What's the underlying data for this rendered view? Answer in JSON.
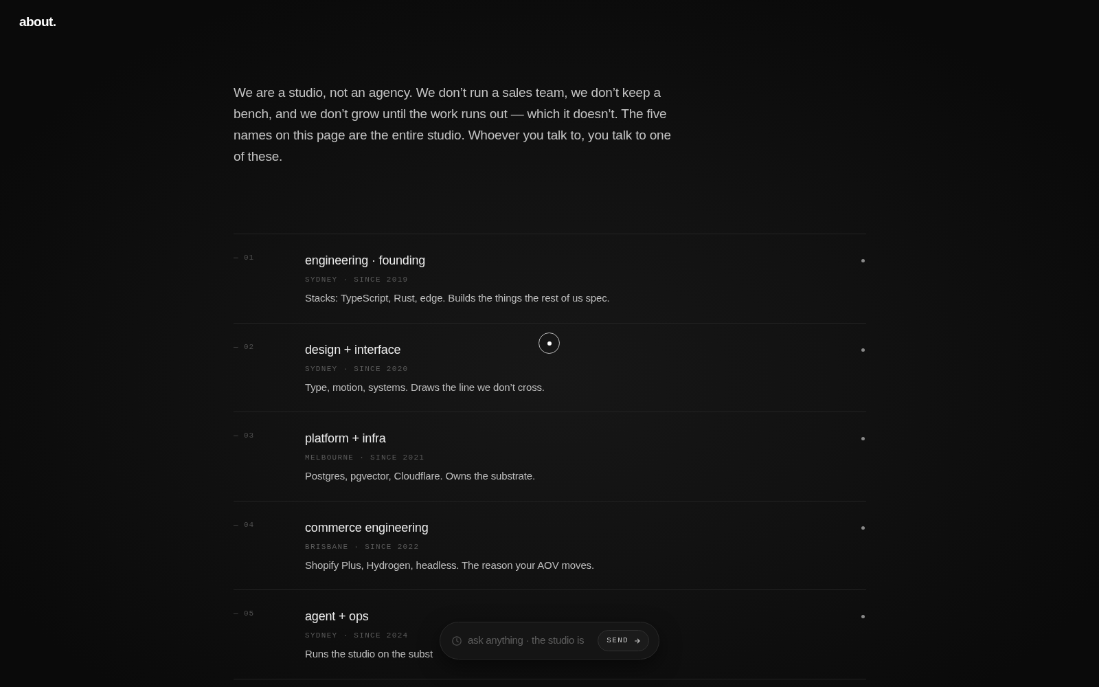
{
  "logo": "about.",
  "intro": "We are a studio, not an agency. We don’t run a sales team, we don’t keep a bench, and we don’t grow until the work runs out — which it doesn’t. The five names on this page are the entire studio. Whoever you talk to, you talk to one of these.",
  "team": [
    {
      "number": "— 01",
      "title": "engineering · founding",
      "meta": "SYDNEY · SINCE 2019",
      "description": "Stacks: TypeScript, Rust, edge. Builds the things the rest of us spec."
    },
    {
      "number": "— 02",
      "title": "design + interface",
      "meta": "SYDNEY · SINCE 2020",
      "description": "Type, motion, systems. Draws the line we don’t cross."
    },
    {
      "number": "— 03",
      "title": "platform + infra",
      "meta": "MELBOURNE · SINCE 2021",
      "description": "Postgres, pgvector, Cloudflare. Owns the substrate."
    },
    {
      "number": "— 04",
      "title": "commerce engineering",
      "meta": "BRISBANE · SINCE 2022",
      "description": "Shopify Plus, Hydrogen, headless. The reason your AOV moves."
    },
    {
      "number": "— 05",
      "title": "agent + ops",
      "meta": "SYDNEY · SINCE 2024",
      "description": "Runs the studio on the subst"
    }
  ],
  "chat": {
    "placeholder": "ask anything · the studio is",
    "send_button": "SEND"
  }
}
